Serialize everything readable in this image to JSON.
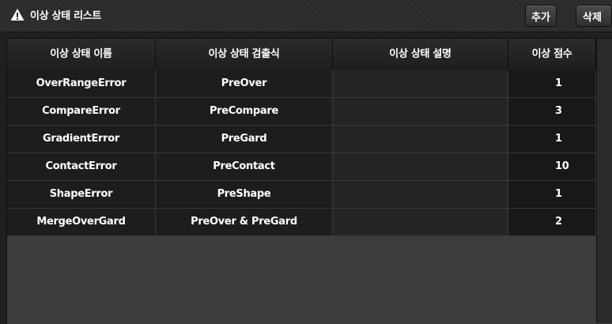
{
  "header": {
    "title": "이상 상태 리스트",
    "add_label": "추가",
    "delete_label": "삭제"
  },
  "table": {
    "columns": [
      "이상 상태 이름",
      "이상 상태 검출식",
      "이상 상태 설명",
      "이상 점수"
    ],
    "rows": [
      {
        "name": "OverRangeError",
        "expr": "PreOver",
        "desc": "",
        "score": "1"
      },
      {
        "name": "CompareError",
        "expr": "PreCompare",
        "desc": "",
        "score": "3"
      },
      {
        "name": "GradientError",
        "expr": "PreGard",
        "desc": "",
        "score": "1"
      },
      {
        "name": "ContactError",
        "expr": "PreContact",
        "desc": "",
        "score": "10"
      },
      {
        "name": "ShapeError",
        "expr": "PreShape",
        "desc": "",
        "score": "1"
      },
      {
        "name": "MergeOverGard",
        "expr": "PreOver & PreGard",
        "desc": "",
        "score": "2"
      }
    ]
  },
  "icons": {
    "title_icon": "warning-icon"
  },
  "colors": {
    "background": "#202020",
    "header": "#2a2a2a",
    "row": "#1d1d1d",
    "text": "#ffffff"
  }
}
